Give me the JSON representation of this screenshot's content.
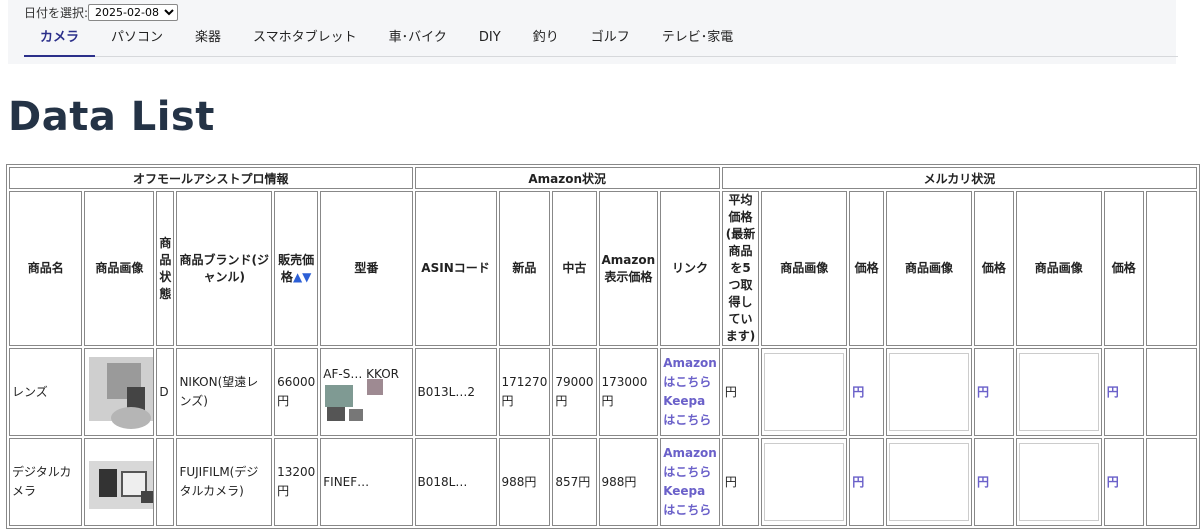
{
  "date_select": {
    "label": "日付を選択:",
    "value": "2025-02-08"
  },
  "tabs": [
    {
      "label": "カメラ",
      "active": true
    },
    {
      "label": "パソコン"
    },
    {
      "label": "楽器"
    },
    {
      "label": "スマホタブレット"
    },
    {
      "label": "車･バイク"
    },
    {
      "label": "DIY"
    },
    {
      "label": "釣り"
    },
    {
      "label": "ゴルフ"
    },
    {
      "label": "テレビ･家電"
    }
  ],
  "page_title": "Data List",
  "table": {
    "groups": [
      "オフモールアシストプロ情報",
      "Amazon状況",
      "メルカリ状況"
    ],
    "headers": {
      "name": "商品名",
      "image": "商品画像",
      "condition": "商品状態",
      "brand": "商品ブランド(ジャンル)",
      "price": "販売価格",
      "sort_arrows": "▲▼",
      "model": "型番",
      "asin": "ASINコード",
      "new": "新品",
      "used": "中古",
      "amazon_price": "Amazon表示価格",
      "link": "リンク",
      "avg": "平均価格(最新商品を5つ取得しています)",
      "m_image": "商品画像",
      "m_price": "価格"
    },
    "rows": [
      {
        "name": "レンズ",
        "condition": "D",
        "brand": "NIKON(望遠レンズ)",
        "price": "66000円",
        "model": "AF-S… KKOR",
        "asin": "B013L…2",
        "new": "171270円",
        "used": "79000円",
        "amazon_price": "173000円",
        "link_amazon": "Amazonはこちら",
        "link_keepa": "Keepaはこちら",
        "avg": "円",
        "m_price": "円"
      },
      {
        "name": "デジタルカメラ",
        "condition": "",
        "brand": "FUJIFILM(デジタルカメラ)",
        "price": "13200円",
        "model": "FINEF…",
        "asin": "B018L…",
        "new": "988円",
        "used": "857円",
        "amazon_price": "988円",
        "link_amazon": "Amazonはこちら",
        "link_keepa": "Keepaはこちら",
        "avg": "円",
        "m_price": "円"
      }
    ]
  }
}
